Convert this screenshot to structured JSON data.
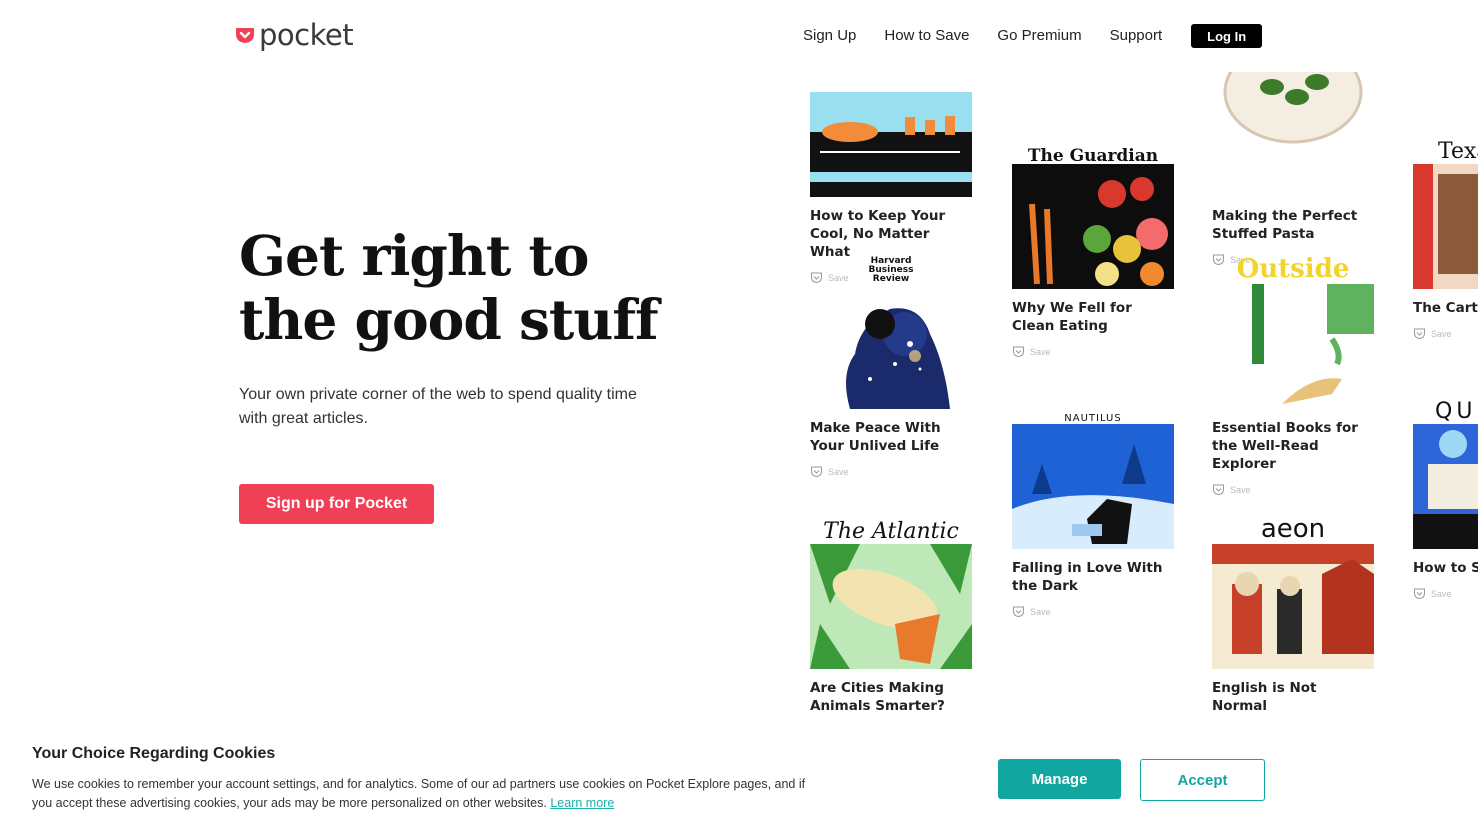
{
  "header": {
    "logo_text": "pocket",
    "nav": [
      "Sign Up",
      "How to Save",
      "Go Premium",
      "Support"
    ],
    "login_label": "Log In"
  },
  "hero": {
    "title_line1": "Get right to",
    "title_line2": "the good stuff",
    "subtitle": "Your own private corner of the web to spend quality time with great articles.",
    "cta_label": "Sign up for Pocket"
  },
  "cards": [
    {
      "publisher": "",
      "title": "How to Keep Your Cool, No Matter What",
      "save": "Save"
    },
    {
      "publisher": "Harvard Business Review",
      "title": "Make Peace With Your Unlived Life",
      "save": "Save"
    },
    {
      "publisher": "The Atlantic",
      "title": "Are Cities Making Animals Smarter?",
      "save": ""
    },
    {
      "publisher": "The Guardian",
      "title": "Why We Fell for Clean Eating",
      "save": "Save"
    },
    {
      "publisher": "NAUTILUS",
      "title": "Falling in Love With the Dark",
      "save": "Save"
    },
    {
      "publisher": "",
      "title": "Making the Perfect Stuffed Pasta",
      "save": "Save"
    },
    {
      "publisher": "Outside",
      "title": "Essential Books for the Well-Read Explorer",
      "save": "Save"
    },
    {
      "publisher": "aeon",
      "title": "English is Not Normal",
      "save": ""
    },
    {
      "publisher": "Texas",
      "title": "The Carte",
      "save": "Save"
    },
    {
      "publisher": "QU",
      "title": "How to St Day Bette",
      "save": "Save"
    }
  ],
  "cookie": {
    "title": "Your Choice Regarding Cookies",
    "text": "We use cookies to remember your account settings, and for analytics. Some of our ad partners use cookies on Pocket Explore pages, and if you accept these advertising cookies, your ads may be more personalized on other websites.",
    "learn_more": "Learn more",
    "manage_label": "Manage",
    "accept_label": "Accept"
  },
  "colors": {
    "brand_red": "#ef4056",
    "teal": "#11a69f"
  }
}
